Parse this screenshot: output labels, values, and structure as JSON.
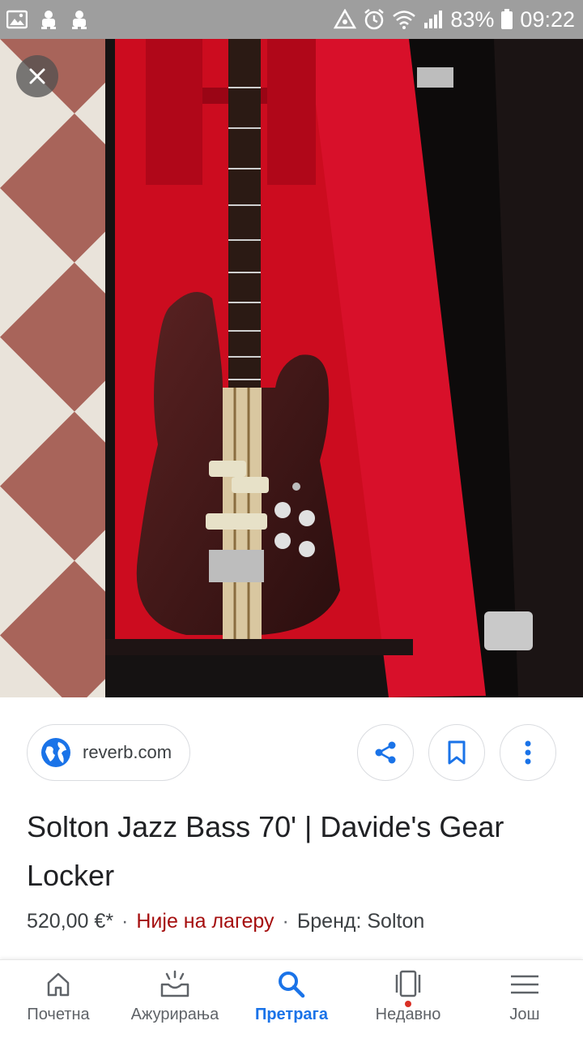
{
  "status_bar": {
    "battery": "83%",
    "time": "09:22",
    "icons": [
      "gallery-icon",
      "android-icon",
      "android-icon",
      "recycle-icon",
      "alarm-icon",
      "wifi-icon",
      "signal-icon",
      "battery-icon"
    ]
  },
  "image": {
    "close_icon": "close-icon",
    "description_colors": {
      "case_lining": "#d0021b",
      "bass_body": "#3a1616"
    }
  },
  "result": {
    "source_domain": "reverb.com",
    "title": "Solton Jazz Bass 70' | Davide's Gear Locker",
    "price": "520,00 €*",
    "stock": "Није на лагеру",
    "brand": "Бренд: Solton",
    "separator": "·"
  },
  "actions": {
    "share_icon": "share-icon",
    "bookmark_icon": "bookmark-icon",
    "more_icon": "more-vert-icon"
  },
  "bottom_nav": {
    "items": [
      {
        "label": "Почетна",
        "icon": "home-icon"
      },
      {
        "label": "Ажурирања",
        "icon": "updates-icon"
      },
      {
        "label": "Претрага",
        "icon": "search-icon",
        "active": true
      },
      {
        "label": "Недавно",
        "icon": "recent-icon"
      },
      {
        "label": "Још",
        "icon": "menu-icon"
      }
    ]
  },
  "colors": {
    "accent": "#1a73e8",
    "stock_red": "#a50e0e",
    "status_bar": "#9e9e9e"
  }
}
